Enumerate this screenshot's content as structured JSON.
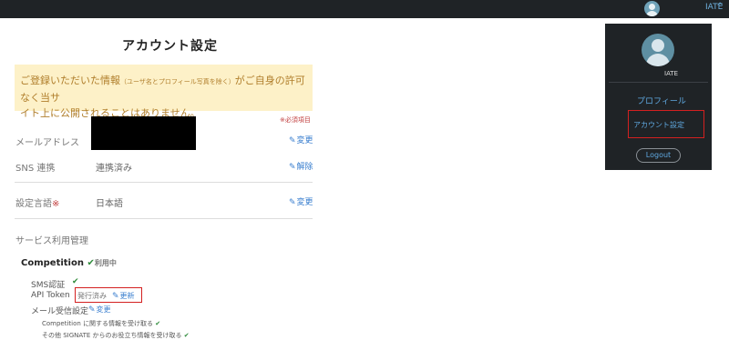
{
  "topbar": {
    "user_label": "IATE",
    "chevron_icon": "chevron-up-icon"
  },
  "page": {
    "title": "アカウント設定"
  },
  "notice": {
    "part1": "ご登録いただいた情報",
    "part_small": "（ユーザ名とプロフィール写真を除く）",
    "part2": "がご自身の許可なく当サ",
    "line2": "イト上に公開されることはありません。"
  },
  "required_note": "※必須項目",
  "fields": {
    "email": {
      "label": "メールアドレス",
      "edit": "変更"
    },
    "sns": {
      "label": "SNS 連携",
      "value": "連携済み",
      "edit": "解除"
    },
    "language": {
      "label": "設定言語",
      "required_mark": "※",
      "value": "日本語",
      "edit": "変更"
    }
  },
  "service": {
    "title": "サービス利用管理",
    "competition": {
      "label": "Competition",
      "status": "利用中"
    },
    "sms": {
      "label": "SMS認証"
    },
    "api_token": {
      "label": "API Token",
      "status": "発行済み",
      "edit": "更新"
    },
    "mail_settings": {
      "label": "メール受信設定",
      "edit": "変更"
    },
    "subs": [
      {
        "label": "Competition に関する情報を受け取る"
      },
      {
        "label": "その他 SIGNATE からのお役立ち情報を受け取る"
      }
    ]
  },
  "dropdown": {
    "user_name": "IATE",
    "items": {
      "profile": "プロフィール",
      "account": "アカウント設定",
      "logout": "Logout"
    }
  },
  "colors": {
    "topbar": "#1f2326",
    "accent_link": "#3a7fcf",
    "notice_bg": "#fdf1c8",
    "notice_text": "#b07e2b",
    "highlight_box": "#d42020",
    "check": "#2e8b3a"
  }
}
